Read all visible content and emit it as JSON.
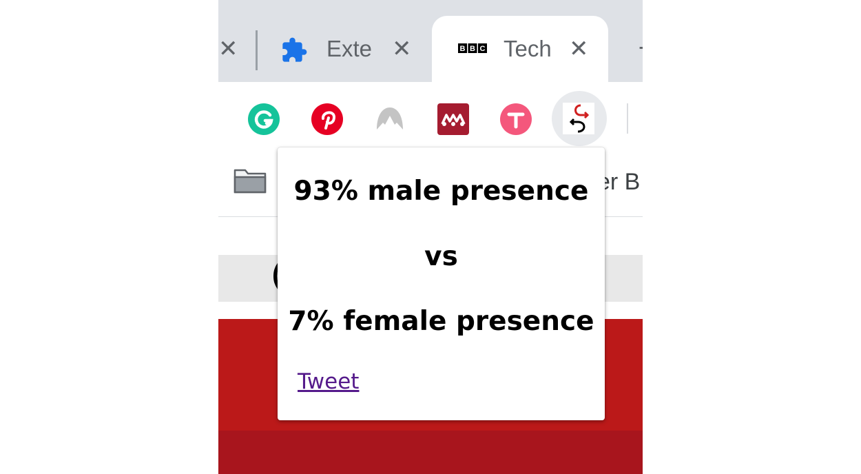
{
  "tabs": [
    {
      "label": "",
      "close_glyph": "✕"
    },
    {
      "label": "Exte",
      "icon": "puzzle-icon",
      "close_glyph": "✕"
    },
    {
      "label": "Tech",
      "icon": "bbc-logo",
      "close_glyph": "✕",
      "active": true
    }
  ],
  "tab_new_glyph": "+",
  "extensions": [
    "grammarly-icon",
    "pinterest-icon",
    "nordvpn-icon",
    "mendeley-icon",
    "tweetdeck-icon",
    "gender-balance-icon"
  ],
  "bookmarks": {
    "partial_label": "er B",
    "folder_icon": "folder-icon"
  },
  "page": {
    "partial_text": "("
  },
  "popup": {
    "line1": "93% male presence",
    "line2": "vs",
    "line3": "7% female presence",
    "tweet_link": "Tweet"
  },
  "colors": {
    "tabstrip": "#dee1e6",
    "bbc_red": "#bb1919",
    "link": "#551a8b"
  }
}
